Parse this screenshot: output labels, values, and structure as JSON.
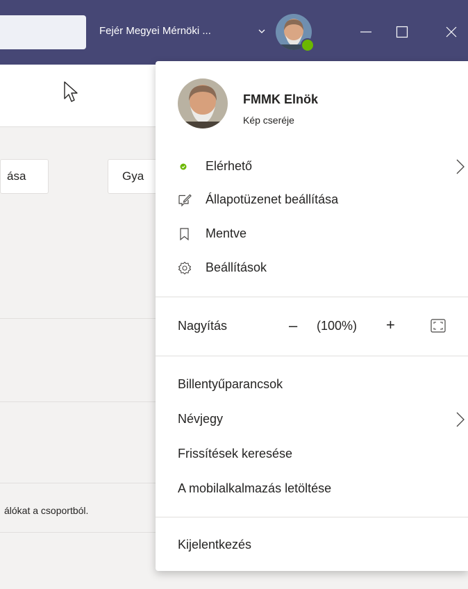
{
  "titlebar": {
    "org_name": "Fejér Megyei Mérnöki ...",
    "presence_color": "#6bb700",
    "bar_color": "#464775"
  },
  "background": {
    "button_1_text": "ása",
    "button_2_text": "Gya",
    "hint_text": "álókat a csoportból."
  },
  "profile_menu": {
    "name": "FMMK Elnök",
    "change_picture": "Kép cseréje",
    "status": "Elérhető",
    "set_status_message": "Állapotüzenet beállítása",
    "saved": "Mentve",
    "settings": "Beállítások",
    "zoom": {
      "label": "Nagyítás",
      "minus": "–",
      "value": "(100%)",
      "plus": "+"
    },
    "keyboard_shortcuts": "Billentyűparancsok",
    "about": "Névjegy",
    "check_updates": "Frissítések keresése",
    "download_mobile": "A mobilalkalmazás letöltése",
    "sign_out": "Kijelentkezés"
  }
}
